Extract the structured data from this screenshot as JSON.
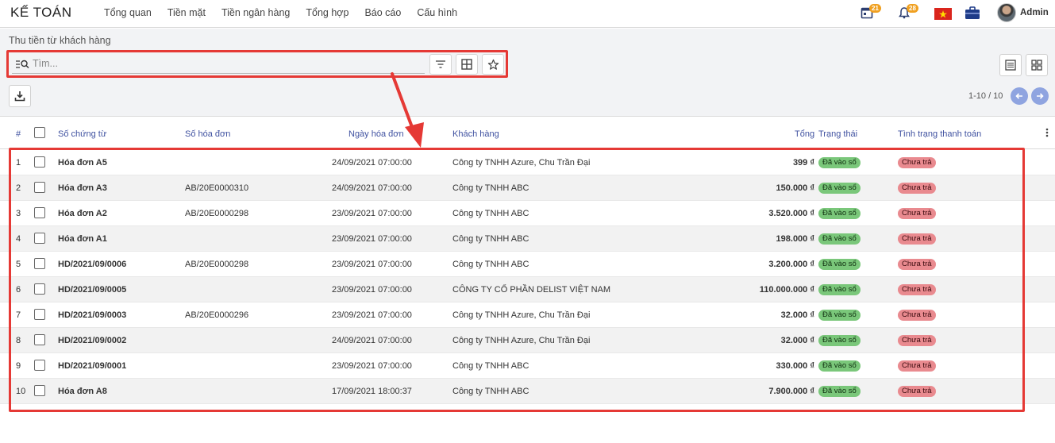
{
  "app": {
    "title": "KẾ TOÁN"
  },
  "nav": {
    "items": [
      "Tổng quan",
      "Tiền mặt",
      "Tiền ngân hàng",
      "Tổng hợp",
      "Báo cáo",
      "Cấu hình"
    ]
  },
  "header": {
    "calendar_badge": "21",
    "notification_badge": "28",
    "user_name": "Admin",
    "flag": "vn-flag-icon",
    "briefcase": "briefcase-icon"
  },
  "breadcrumb": "Thu tiền từ khách hàng",
  "search": {
    "placeholder": "Tìm..."
  },
  "pager": {
    "text": "1-10 / 10"
  },
  "table": {
    "headers": {
      "index": "#",
      "doc": "Số chứng từ",
      "invoice": "Số hóa đơn",
      "date": "Ngày hóa đơn",
      "customer": "Khách hàng",
      "total": "Tổng",
      "status": "Trạng thái",
      "payment": "Tình trạng thanh toán"
    },
    "rows": [
      {
        "n": "1",
        "doc": "Hóa đơn A5",
        "invoice": "",
        "date": "24/09/2021 07:00:00",
        "customer": "Công ty TNHH Azure, Chu Trần Đại",
        "total": "399 ₫",
        "status": "Đã vào sổ",
        "payment": "Chưa trả"
      },
      {
        "n": "2",
        "doc": "Hóa đơn A3",
        "invoice": "AB/20E0000310",
        "date": "24/09/2021 07:00:00",
        "customer": "Công ty TNHH ABC",
        "total": "150.000 ₫",
        "status": "Đã vào sổ",
        "payment": "Chưa trả"
      },
      {
        "n": "3",
        "doc": "Hóa đơn A2",
        "invoice": "AB/20E0000298",
        "date": "23/09/2021 07:00:00",
        "customer": "Công ty TNHH ABC",
        "total": "3.520.000 ₫",
        "status": "Đã vào sổ",
        "payment": "Chưa trả"
      },
      {
        "n": "4",
        "doc": "Hóa đơn A1",
        "invoice": "",
        "date": "23/09/2021 07:00:00",
        "customer": "Công ty TNHH ABC",
        "total": "198.000 ₫",
        "status": "Đã vào sổ",
        "payment": "Chưa trả"
      },
      {
        "n": "5",
        "doc": "HD/2021/09/0006",
        "invoice": "AB/20E0000298",
        "date": "23/09/2021 07:00:00",
        "customer": "Công ty TNHH ABC",
        "total": "3.200.000 ₫",
        "status": "Đã vào sổ",
        "payment": "Chưa trả"
      },
      {
        "n": "6",
        "doc": "HD/2021/09/0005",
        "invoice": "",
        "date": "23/09/2021 07:00:00",
        "customer": "CÔNG TY CỔ PHẦN DELIST VIỆT NAM",
        "total": "110.000.000 ₫",
        "status": "Đã vào sổ",
        "payment": "Chưa trả"
      },
      {
        "n": "7",
        "doc": "HD/2021/09/0003",
        "invoice": "AB/20E0000296",
        "date": "23/09/2021 07:00:00",
        "customer": "Công ty TNHH Azure, Chu Trần Đại",
        "total": "32.000 ₫",
        "status": "Đã vào sổ",
        "payment": "Chưa trả"
      },
      {
        "n": "8",
        "doc": "HD/2021/09/0002",
        "invoice": "",
        "date": "24/09/2021 07:00:00",
        "customer": "Công ty TNHH Azure, Chu Trần Đại",
        "total": "32.000 ₫",
        "status": "Đã vào sổ",
        "payment": "Chưa trả"
      },
      {
        "n": "9",
        "doc": "HD/2021/09/0001",
        "invoice": "",
        "date": "23/09/2021 07:00:00",
        "customer": "Công ty TNHH ABC",
        "total": "330.000 ₫",
        "status": "Đã vào sổ",
        "payment": "Chưa trả"
      },
      {
        "n": "10",
        "doc": "Hóa đơn A8",
        "invoice": "",
        "date": "17/09/2021 18:00:37",
        "customer": "Công ty TNHH ABC",
        "total": "7.900.000 ₫",
        "status": "Đã vào sổ",
        "payment": "Chưa trả"
      }
    ]
  },
  "colors": {
    "accent": "#3f51a0",
    "highlight": "#e53935",
    "status_green": "#7ac77a",
    "payment_red": "#e98a8f"
  }
}
